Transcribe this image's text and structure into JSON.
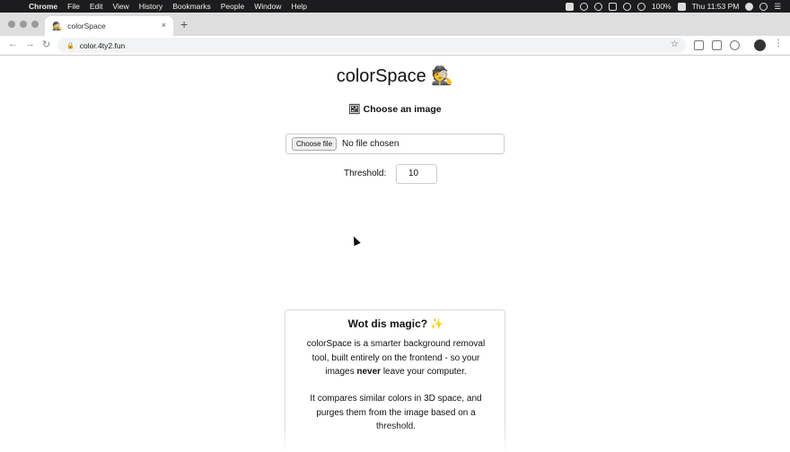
{
  "menubar": {
    "apple_icon": "apple-icon",
    "app_name": "Chrome",
    "items": [
      "File",
      "Edit",
      "View",
      "History",
      "Bookmarks",
      "People",
      "Window",
      "Help"
    ],
    "battery": "100%",
    "clock": "Thu 11:53 PM"
  },
  "browser": {
    "tab_title": "colorSpace",
    "tab_favicon": "🕵",
    "tab_close": "×",
    "new_tab": "+",
    "url": "color.4ty2.fun"
  },
  "page": {
    "title": "colorSpace 🕵",
    "choose_heading": "🖼 Choose an image",
    "file_button": "Choose file",
    "file_status": "No file chosen",
    "threshold_label": "Threshold:",
    "threshold_value": "10"
  },
  "info": {
    "title": "Wot dis magic? ✨",
    "p1_a": "colorSpace is a smarter background removal tool, built entirely on the frontend - so your images ",
    "p1_bold": "never",
    "p1_b": " leave your computer.",
    "p2": "It compares similar colors in 3D space, and purges them from the image based on a threshold."
  }
}
